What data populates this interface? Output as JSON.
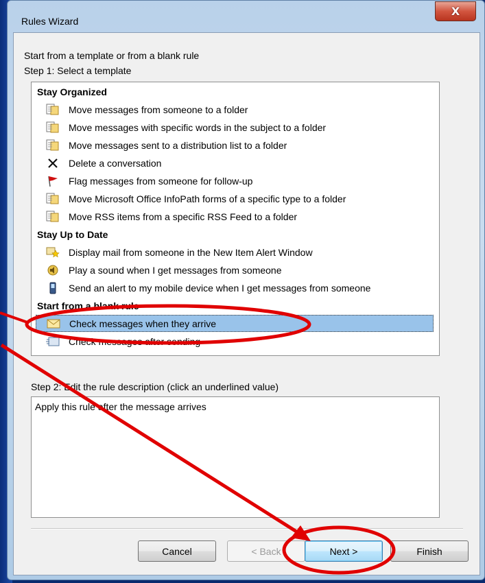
{
  "window": {
    "title": "Rules Wizard",
    "close_glyph": "X"
  },
  "intro": {
    "line1": "Start from a template or from a blank rule",
    "line2": "Step 1: Select a template"
  },
  "templates": {
    "groups": [
      {
        "name": "Stay Organized",
        "items": [
          {
            "icon": "move-to-folder-icon",
            "label": "Move messages from someone to a folder"
          },
          {
            "icon": "move-to-folder-icon",
            "label": "Move messages with specific words in the subject to a folder"
          },
          {
            "icon": "move-to-folder-icon",
            "label": "Move messages sent to a distribution list to a folder"
          },
          {
            "icon": "delete-x-icon",
            "label": "Delete a conversation"
          },
          {
            "icon": "flag-icon",
            "label": "Flag messages from someone for follow-up"
          },
          {
            "icon": "move-to-folder-icon",
            "label": "Move Microsoft Office InfoPath forms of a specific type to a folder"
          },
          {
            "icon": "move-to-folder-icon",
            "label": "Move RSS items from a specific RSS Feed to a folder"
          }
        ]
      },
      {
        "name": "Stay Up to Date",
        "items": [
          {
            "icon": "alert-star-icon",
            "label": "Display mail from someone in the New Item Alert Window"
          },
          {
            "icon": "speaker-icon",
            "label": "Play a sound when I get messages from someone"
          },
          {
            "icon": "mobile-device-icon",
            "label": "Send an alert to my mobile device when I get messages from someone"
          }
        ]
      },
      {
        "name": "Start from a blank rule",
        "items": [
          {
            "icon": "envelope-icon",
            "label": "Check messages when they arrive",
            "selected": true
          },
          {
            "icon": "sent-message-icon",
            "label": "Check messages after sending"
          }
        ]
      }
    ]
  },
  "step2": {
    "label": "Step 2: Edit the rule description (click an underlined value)",
    "description": "Apply this rule after the message arrives"
  },
  "buttons": {
    "cancel": "Cancel",
    "back": "< Back",
    "next": "Next >",
    "finish": "Finish"
  },
  "annotation": {
    "color": "#e00000"
  }
}
